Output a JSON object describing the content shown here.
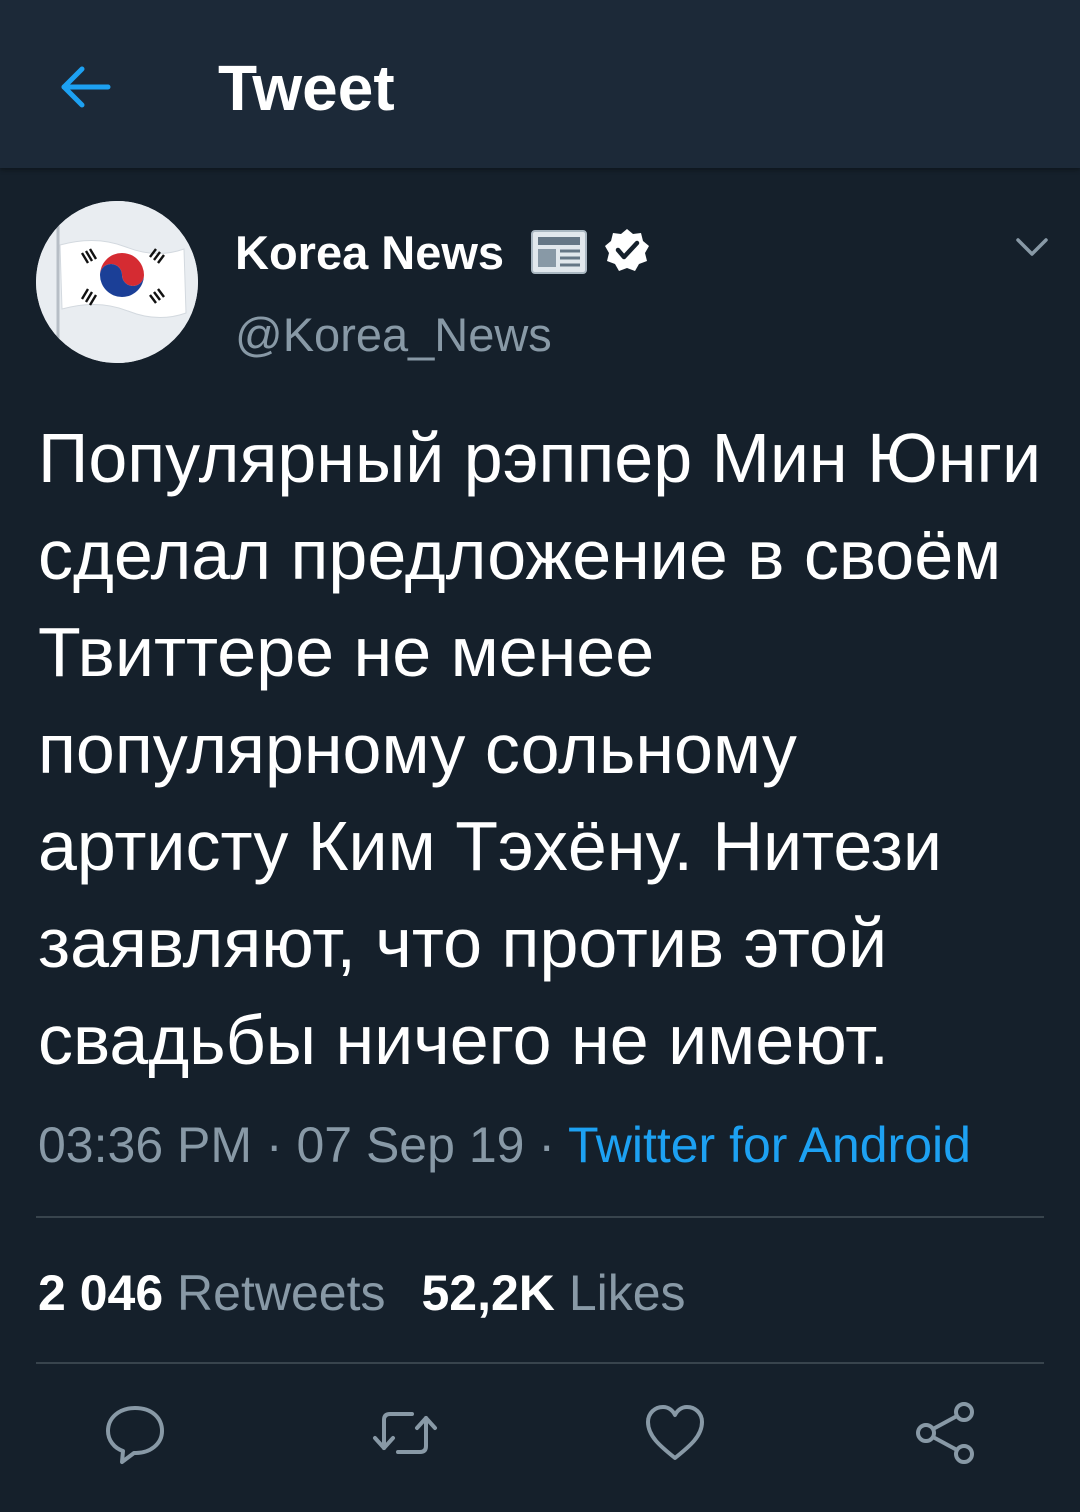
{
  "header": {
    "title": "Tweet",
    "back_icon": "arrow-left-icon"
  },
  "tweet": {
    "author": {
      "name": "Korea News",
      "handle": "@Korea_News",
      "name_emoji": "newspaper-icon",
      "verified_icon": "verified-badge-icon",
      "avatar": "south-korea-flag-avatar"
    },
    "text": "Популярный рэппер Мин Юнги сделал предложение в своём Твиттере не менее популярному сольному артисту Ким Тэхёну. Нитези заявляют, что против этой свадьбы ничего не имеют.",
    "time": "03:36 PM",
    "date": "07 Sep 19",
    "separator": " · ",
    "source": "Twitter for Android",
    "stats": {
      "retweets_count": "2 046",
      "retweets_label": "Retweets",
      "likes_count": "52,2K",
      "likes_label": "Likes"
    }
  },
  "actions": {
    "icons": [
      "reply-icon",
      "retweet-icon",
      "like-icon",
      "share-icon"
    ]
  },
  "colors": {
    "background": "#15202b",
    "header_background": "#1c2938",
    "accent": "#1da1f2",
    "secondary_text": "#8899a6",
    "divider": "#38444d"
  }
}
